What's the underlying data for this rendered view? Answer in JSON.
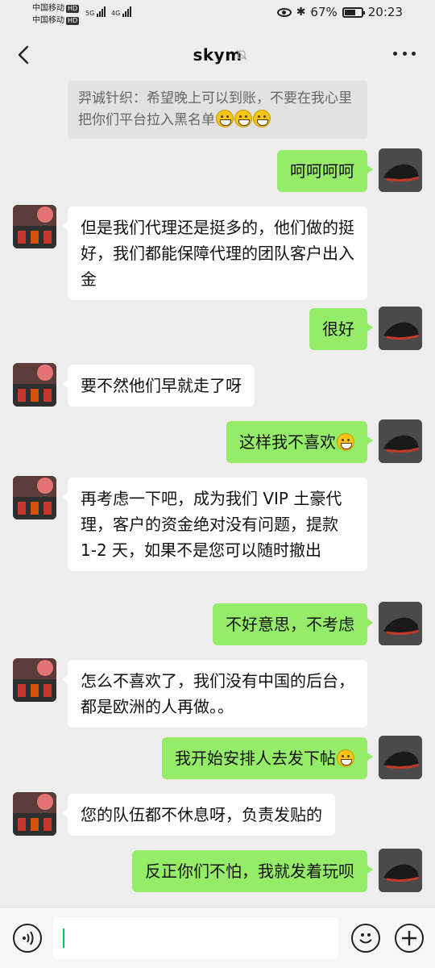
{
  "status_bar": {
    "carrier1": "中国移动",
    "carrier2": "中国移动",
    "hd": "HD",
    "net1": "5G",
    "net2": "4G",
    "battery": "67%",
    "battery_level": 0.67,
    "time": "20:23"
  },
  "header": {
    "title": "skym",
    "back_icon": "chevron-left",
    "mute_icon": "bell-off",
    "more_icon": "ellipsis"
  },
  "quote": {
    "text": "羿诚针织：希望晚上可以到账，不要在我心里把你们平台拉入黑名单",
    "emoji_count": 3
  },
  "messages": [
    {
      "side": "right",
      "text": "呵呵呵呵",
      "emoji": 0
    },
    {
      "side": "left",
      "text": "但是我们代理还是挺多的，他们做的挺好，我们都能保障代理的团队客户出入金",
      "emoji": 0
    },
    {
      "side": "right",
      "text": "很好",
      "emoji": 0
    },
    {
      "side": "left",
      "text": "要不然他们早就走了呀",
      "emoji": 0
    },
    {
      "side": "right",
      "text": "这样我不喜欢",
      "emoji": 1
    },
    {
      "side": "left",
      "text": "再考虑一下吧，成为我们 VIP 土豪代理，客户的资金绝对没有问题，提款 1-2 天，如果不是您可以随时撤出",
      "emoji": 0
    },
    {
      "side": "right",
      "text": "不好意思，不考虑",
      "emoji": 0
    },
    {
      "side": "left",
      "text": "怎么不喜欢了，我们没有中国的后台，都是欧洲的人再做。。",
      "emoji": 0
    },
    {
      "side": "right",
      "text": "我开始安排人去发下帖",
      "emoji": 1
    },
    {
      "side": "left",
      "text": "您的队伍都不休息呀，负责发贴的",
      "emoji": 0
    },
    {
      "side": "right",
      "text": "反正你们不怕，我就发着玩呗",
      "emoji": 0
    }
  ],
  "input_bar": {
    "voice_icon": "voice-wave",
    "emoji_icon": "smiley-face",
    "plus_icon": "plus-circle",
    "input_value": ""
  },
  "colors": {
    "background": "#ededed",
    "right_bubble": "#95ec69",
    "left_bubble": "#ffffff",
    "quote_bg": "#e2e2e2",
    "caret": "#07c160"
  }
}
